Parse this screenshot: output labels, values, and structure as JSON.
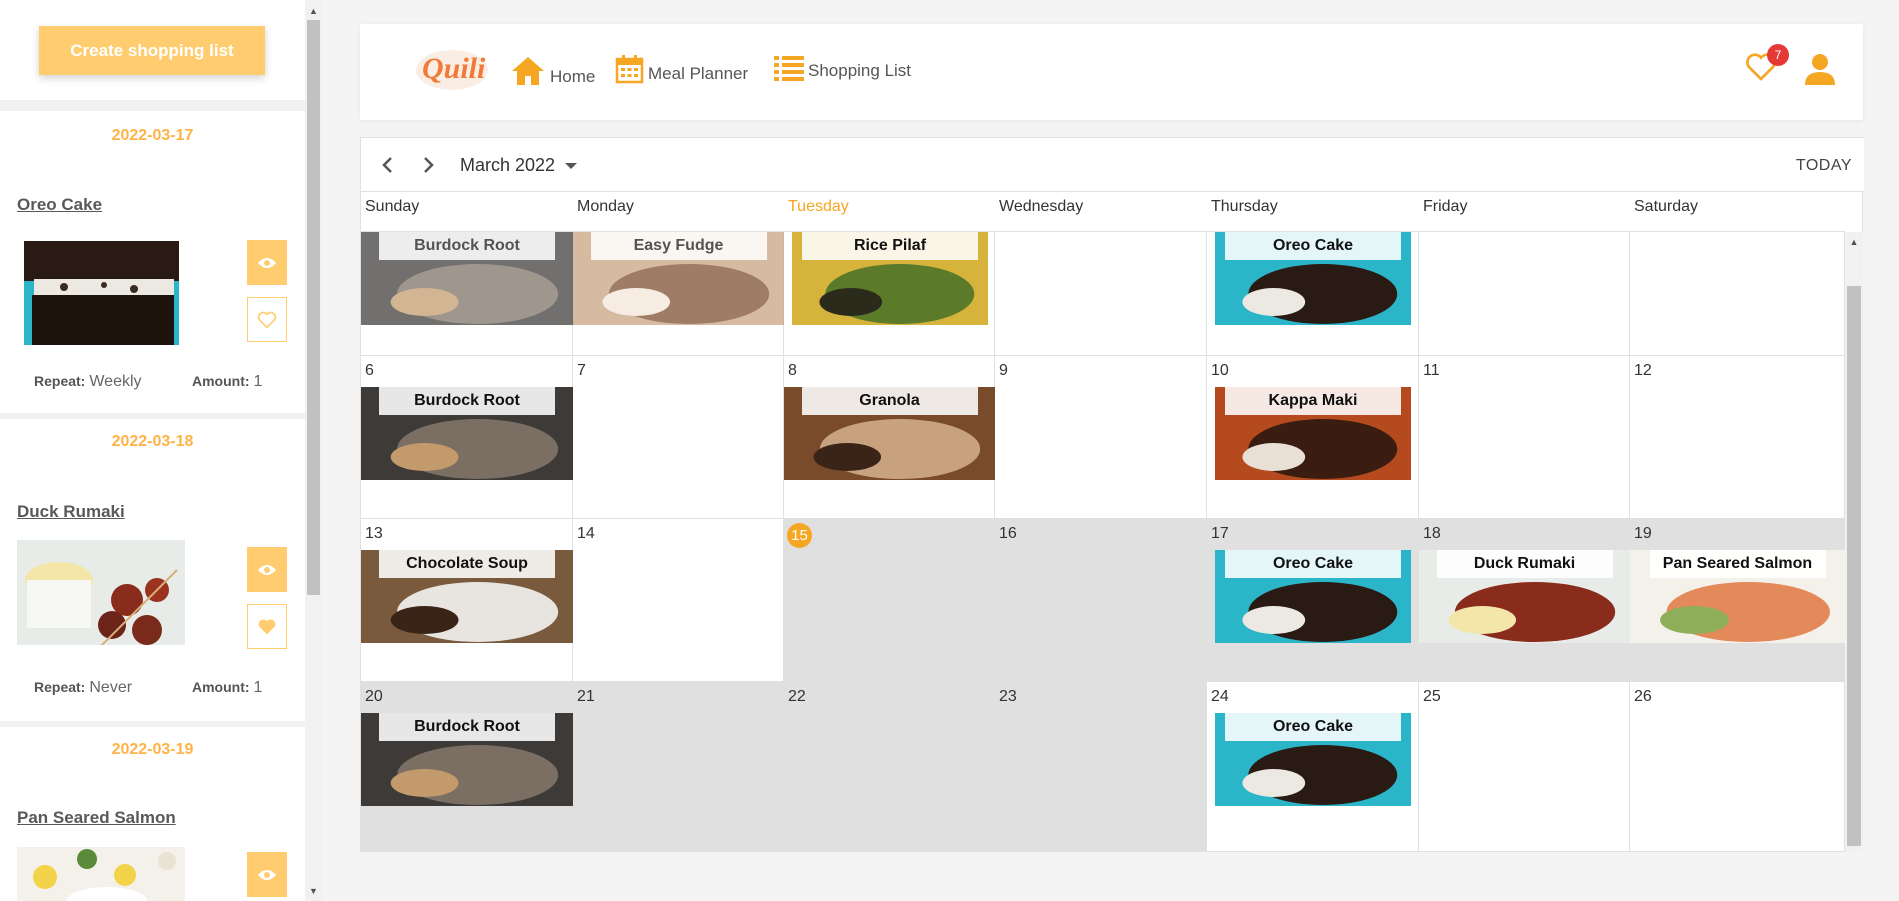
{
  "sidebar": {
    "create_label": "Create shopping list",
    "cards": [
      {
        "date": "2022-03-17",
        "title": "Oreo Cake",
        "repeat_label": "Repeat:",
        "repeat": "Weekly",
        "amount_label": "Amount:",
        "amount": "1",
        "favorited": false
      },
      {
        "date": "2022-03-18",
        "title": "Duck Rumaki",
        "repeat_label": "Repeat:",
        "repeat": "Never",
        "amount_label": "Amount:",
        "amount": "1",
        "favorited": true
      },
      {
        "date": "2022-03-19",
        "title": "Pan Seared Salmon",
        "repeat_label": "",
        "repeat": "",
        "amount_label": "",
        "amount": "",
        "favorited": false
      }
    ]
  },
  "header": {
    "logo_text": "Quili",
    "nav": {
      "home": "Home",
      "meal_planner": "Meal Planner",
      "shopping_list": "Shopping List"
    },
    "favorites_count": "7",
    "accent": "#f5a623"
  },
  "calendar": {
    "month": "March 2022",
    "today_label": "TODAY",
    "weekdays": [
      "Sunday",
      "Monday",
      "Tuesday",
      "Wednesday",
      "Thursday",
      "Friday",
      "Saturday"
    ],
    "active_weekday": "Tuesday",
    "weeks": [
      {
        "days": [
          "",
          "",
          "",
          "",
          "",
          "",
          ""
        ],
        "meals": {
          "0": "Burdock Root",
          "1": "Easy Fudge",
          "2": "Rice Pilaf",
          "4": "Oreo Cake"
        }
      },
      {
        "days": [
          "6",
          "7",
          "8",
          "9",
          "10",
          "11",
          "12"
        ],
        "meals": {
          "0": "Burdock Root",
          "2": "Granola",
          "4": "Kappa Maki"
        }
      },
      {
        "days": [
          "13",
          "14",
          "15",
          "16",
          "17",
          "18",
          "19"
        ],
        "meals": {
          "0": "Chocolate Soup",
          "4": "Oreo Cake",
          "5": "Duck Rumaki",
          "6": "Pan Seared Salmon"
        }
      },
      {
        "days": [
          "20",
          "21",
          "22",
          "23",
          "24",
          "25",
          "26"
        ],
        "meals": {
          "0": "Burdock Root",
          "4": "Oreo Cake"
        }
      }
    ],
    "today": "15"
  }
}
